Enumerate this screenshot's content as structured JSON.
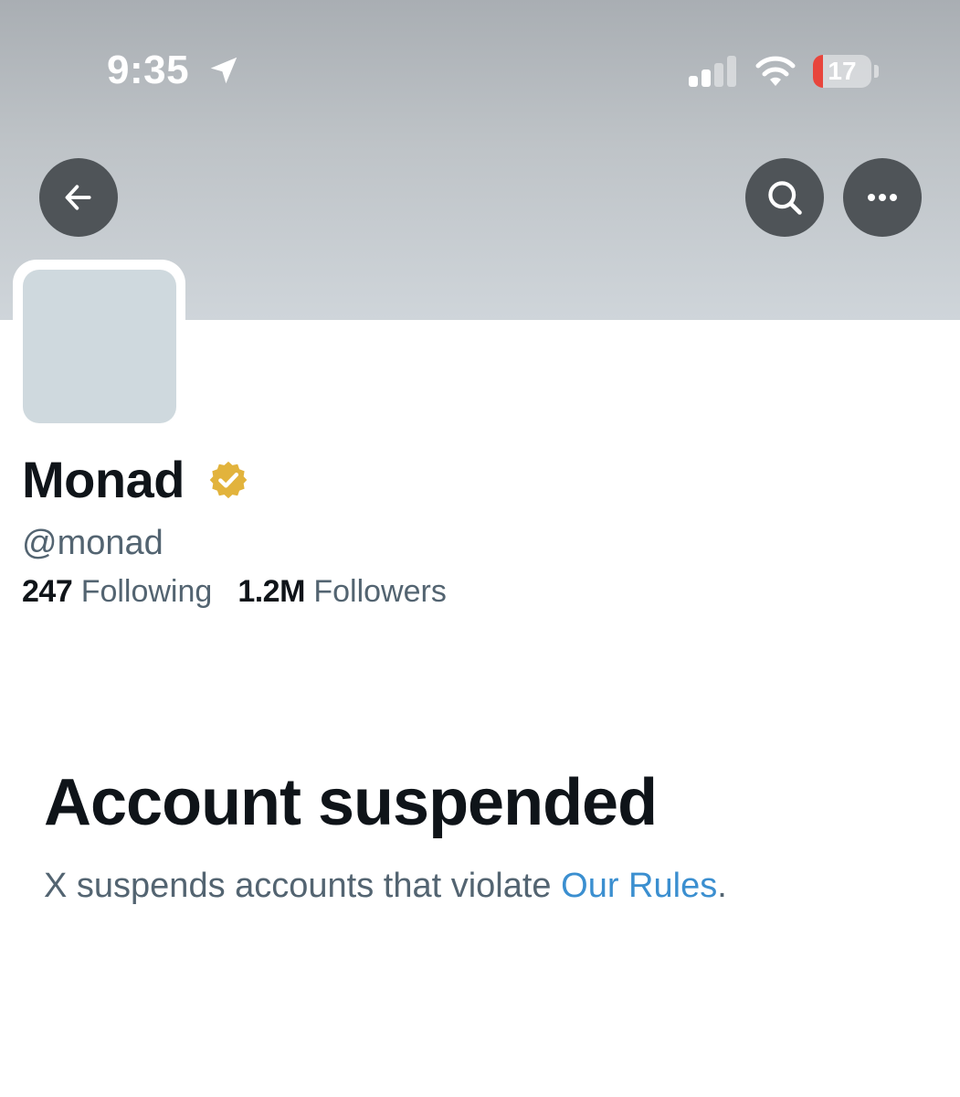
{
  "status_bar": {
    "time": "9:35",
    "battery_level": "17",
    "battery_fraction": 0.17,
    "icons": [
      "location-arrow-icon",
      "cellular-signal-icon",
      "wifi-icon",
      "battery-icon"
    ]
  },
  "header": {
    "buttons": [
      "back-arrow-icon",
      "search-icon",
      "more-options-icon"
    ]
  },
  "profile": {
    "display_name": "Monad",
    "verified_badge": "gold-verified-icon",
    "handle": "@monad",
    "following_count": "247",
    "following_label": "Following",
    "followers_count": "1.2M",
    "followers_label": "Followers"
  },
  "suspension": {
    "title": "Account suspended",
    "message_prefix": "X suspends accounts that violate",
    "rules_link": "Our Rules",
    "message_suffix": "."
  },
  "colors": {
    "text_primary": "#0f1419",
    "text_secondary": "#536471",
    "link": "#3b8fd0",
    "verified_gold": "#e2b33c",
    "button_bg": "#4f5458",
    "battery_low": "#e8453c"
  }
}
